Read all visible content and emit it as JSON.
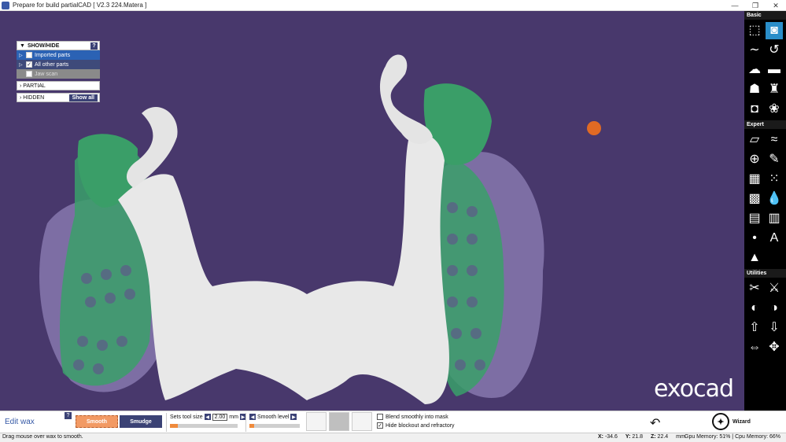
{
  "window": {
    "title": "Prepare for build partialCAD [ V2.3 224.Matera ]",
    "controls": [
      "—",
      "❐",
      "✕"
    ]
  },
  "panel": {
    "header": "SHOW/HIDE",
    "help": "?",
    "items": [
      {
        "label": "Imported parts",
        "checked": false
      },
      {
        "label": "All other parts",
        "checked": true
      },
      {
        "label": "Jaw scan",
        "checked": false
      }
    ],
    "partial": "PARTIAL",
    "hidden": "HIDDEN",
    "show_all": "Show all"
  },
  "logo": "exocad",
  "sidebar": {
    "basic_label": "Basic",
    "expert_label": "Expert",
    "utilities_label": "Utilities"
  },
  "bottom": {
    "mode": "Edit wax",
    "help": "?",
    "smooth": "Smooth",
    "smudge": "Smudge",
    "tool_size_label": "Sets tool size",
    "tool_size_value": "2.00",
    "tool_size_unit": "mm",
    "tool_size_fill": 0.12,
    "smooth_level_label": "Smooth level",
    "smooth_level_fill": 0.1,
    "blend_label": "Blend smoothly into mask",
    "blend_checked": false,
    "hide_label": "Hide blockout and refractory",
    "hide_checked": true,
    "wizard": "Wizard"
  },
  "status": {
    "message": "Drag mouse over wax to smooth.",
    "x_label": "X:",
    "x": "-34.6",
    "y_label": "Y:",
    "y": "21.8",
    "z_label": "Z:",
    "z": "22.4",
    "unit": "mm",
    "memory": "Gpu Memory: 51% | Cpu Memory: 66%"
  },
  "colors": {
    "viewport": "#48386c",
    "mesh_green": "#3aa06a",
    "wax_white": "#e8e8e8",
    "accent_orange": "#ef8a3c"
  }
}
